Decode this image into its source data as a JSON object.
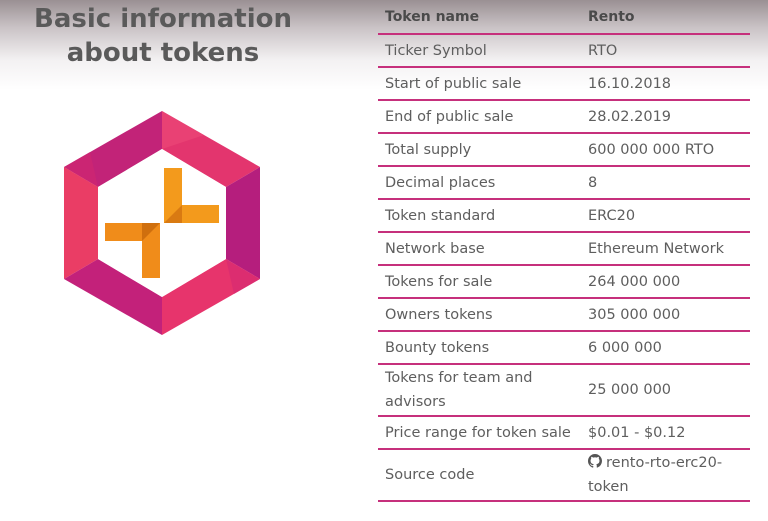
{
  "page": {
    "title": "Basic information about tokens"
  },
  "table": {
    "headers": [
      "Token name",
      "Rento"
    ],
    "rows": [
      {
        "label": "Ticker Symbol",
        "value": "RTO"
      },
      {
        "label": "Start of public sale",
        "value": "16.10.2018"
      },
      {
        "label": "End of public sale",
        "value": "28.02.2019"
      },
      {
        "label": "Total supply",
        "value": "600 000 000 RTO"
      },
      {
        "label": "Decimal places",
        "value": "8"
      },
      {
        "label": "Token standard",
        "value": "ERC20"
      },
      {
        "label": "Network base",
        "value": "Ethereum Network"
      },
      {
        "label": "Tokens for sale",
        "value": "264 000 000"
      },
      {
        "label": "Owners tokens",
        "value": "305 000 000"
      },
      {
        "label": "Bounty tokens",
        "value": "6 000 000"
      },
      {
        "label": "Tokens for team and advisors",
        "value": "25 000 000"
      },
      {
        "label": "Price range for token sale",
        "value": "$0.01 - $0.12"
      },
      {
        "label": "Source code",
        "value": "rento-rto-erc20-token",
        "icon": "github-icon"
      }
    ]
  },
  "colors": {
    "accent": "#c6307c",
    "logo_pink": "#e8356a",
    "logo_magenta": "#b81f7c",
    "logo_orange": "#f08c1a"
  }
}
